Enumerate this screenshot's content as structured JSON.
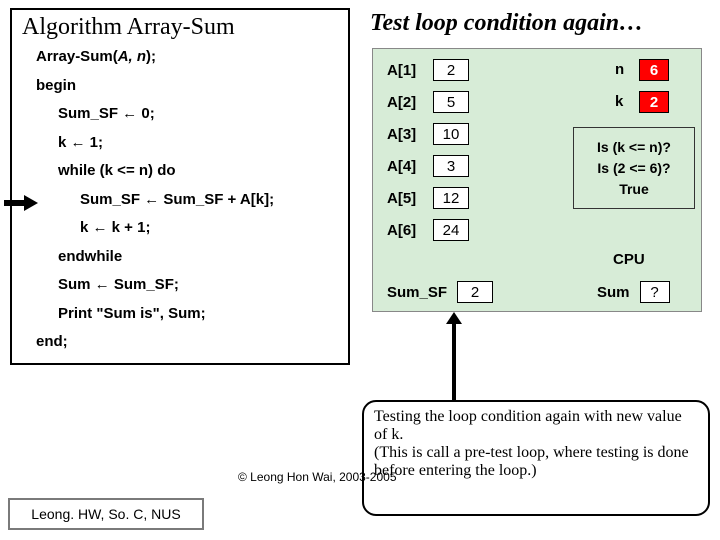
{
  "heading": "Test loop condition again…",
  "algo": {
    "title": "Algorithm Array-Sum",
    "sig_prefix": "Array-Sum(",
    "sig_params": "A, n",
    "sig_suffix": ");",
    "begin": "begin",
    "l1": "Sum_SF ← 0;",
    "l2": "k ← 1;",
    "l3": "while (k <= n) do",
    "l4": "Sum_SF ← Sum_SF + A[k];",
    "l5": "k ← k + 1;",
    "l6": "endwhile",
    "l7": "Sum ← Sum_SF;",
    "l8": "Print \"Sum is\", Sum;",
    "end": "end;"
  },
  "array": [
    {
      "label": "A[1]",
      "value": "2"
    },
    {
      "label": "A[2]",
      "value": "5"
    },
    {
      "label": "A[3]",
      "value": "10"
    },
    {
      "label": "A[4]",
      "value": "3"
    },
    {
      "label": "A[5]",
      "value": "12"
    },
    {
      "label": "A[6]",
      "value": "24"
    }
  ],
  "vars": {
    "n_label": "n",
    "n_value": "6",
    "k_label": "k",
    "k_value": "2",
    "sumsf_label": "Sum_SF",
    "sumsf_value": "2",
    "cpu_label": "CPU",
    "sum_label": "Sum",
    "sum_value": "?"
  },
  "cond": {
    "l1": "Is (k <= n)?",
    "l2": "Is (2 <= 6)?",
    "l3": "True"
  },
  "callout": "Testing the loop condition again with new value of k.\n(This is call a pre-test loop, where testing is done before entering the loop.)",
  "copyright": "© Leong Hon Wai, 2003-2005",
  "footer": "Leong. HW, So. C, NUS"
}
